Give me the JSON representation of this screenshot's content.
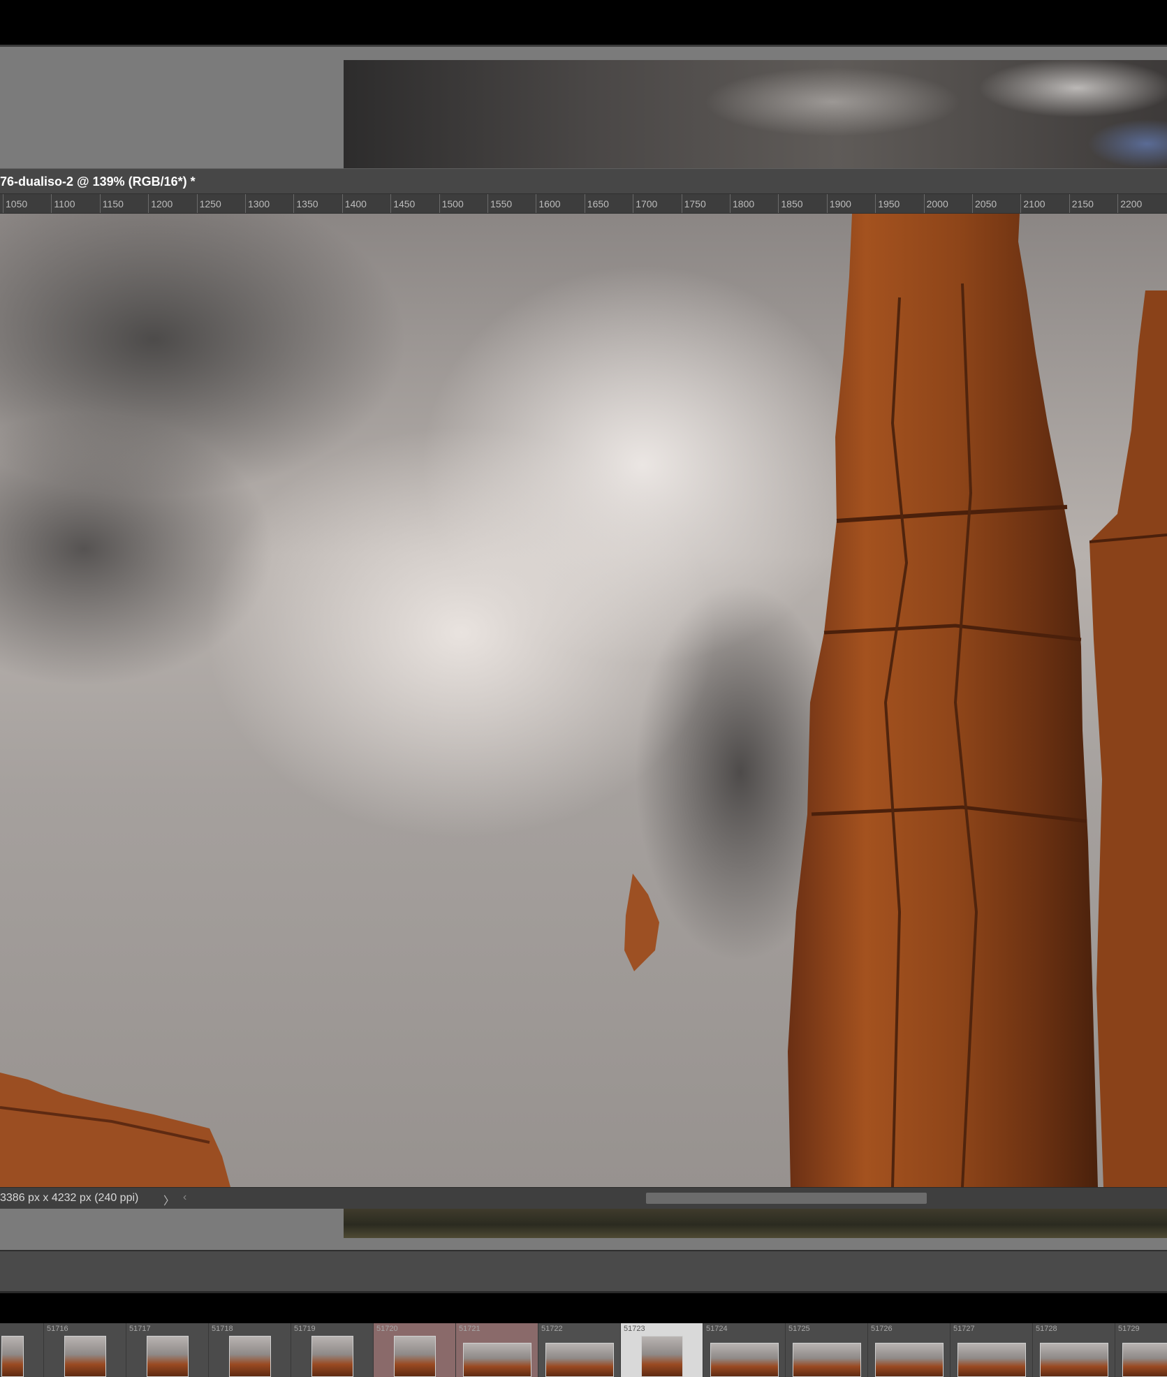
{
  "document": {
    "title": "76-dualiso-2 @ 139% (RGB/16*) *",
    "ruler_ticks": [
      "1050",
      "1100",
      "1150",
      "1200",
      "1250",
      "1300",
      "1350",
      "1400",
      "1450",
      "1500",
      "1550",
      "1600",
      "1650",
      "1700",
      "1750",
      "1800",
      "1850",
      "1900",
      "1950",
      "2000",
      "2050",
      "2100",
      "2150",
      "2200"
    ],
    "status_text": "3386 px x 4232 px (240 ppi)",
    "status_arrow_right": "〉",
    "status_arrow_left": "‹"
  },
  "filmstrip": {
    "items": [
      {
        "label": "",
        "state": "normal",
        "thumb": "portrait"
      },
      {
        "label": "51716",
        "state": "normal",
        "thumb": "portrait"
      },
      {
        "label": "51717",
        "state": "normal",
        "thumb": "portrait"
      },
      {
        "label": "51718",
        "state": "normal",
        "thumb": "portrait"
      },
      {
        "label": "51719",
        "state": "normal",
        "thumb": "portrait"
      },
      {
        "label": "51720",
        "state": "pink",
        "thumb": "portrait"
      },
      {
        "label": "51721",
        "state": "pink",
        "thumb": "landscape"
      },
      {
        "label": "51722",
        "state": "dim",
        "thumb": "landscape"
      },
      {
        "label": "51723",
        "state": "selected",
        "thumb": "portrait"
      },
      {
        "label": "51724",
        "state": "normal",
        "thumb": "landscape"
      },
      {
        "label": "51725",
        "state": "normal",
        "thumb": "landscape"
      },
      {
        "label": "51726",
        "state": "normal",
        "thumb": "landscape"
      },
      {
        "label": "51727",
        "state": "normal",
        "thumb": "landscape"
      },
      {
        "label": "51728",
        "state": "normal",
        "thumb": "landscape"
      },
      {
        "label": "51729",
        "state": "normal",
        "thumb": "landscape"
      }
    ]
  },
  "colors": {
    "rock": "#9a4a22",
    "rock_dark": "#5e2a12",
    "cloud_light": "#e9e3df",
    "cloud_dark": "#4d4b4a"
  }
}
